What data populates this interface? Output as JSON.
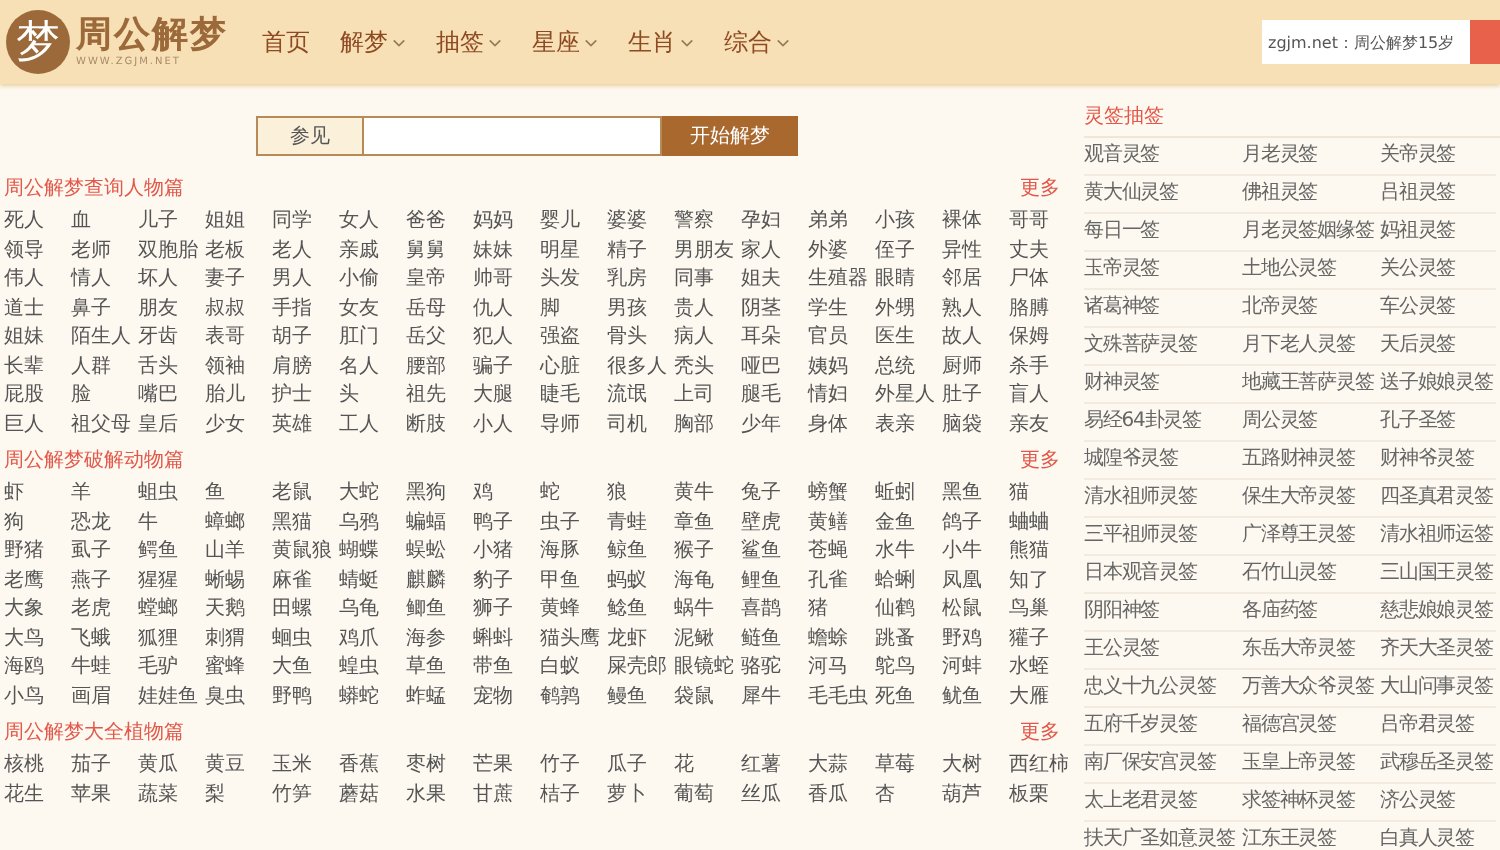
{
  "header": {
    "logo": {
      "mark": "梦",
      "title": "周公解梦",
      "subtitle": "WWW.ZGJM.NET"
    },
    "nav": [
      {
        "label": "首页",
        "has_menu": false
      },
      {
        "label": "解梦",
        "has_menu": true
      },
      {
        "label": "抽签",
        "has_menu": true
      },
      {
        "label": "星座",
        "has_menu": true
      },
      {
        "label": "生肖",
        "has_menu": true
      },
      {
        "label": "综合",
        "has_menu": true
      }
    ],
    "search": {
      "value": "zgjm.net：周公解梦15岁"
    }
  },
  "search": {
    "label": "参见",
    "button": "开始解梦"
  },
  "sections": [
    {
      "title": "周公解梦查询人物篇",
      "more": "更多",
      "items": [
        "死人",
        "血",
        "儿子",
        "姐姐",
        "同学",
        "女人",
        "爸爸",
        "妈妈",
        "婴儿",
        "婆婆",
        "警察",
        "孕妇",
        "弟弟",
        "小孩",
        "裸体",
        "哥哥",
        "领导",
        "老师",
        "双胞胎",
        "老板",
        "老人",
        "亲戚",
        "舅舅",
        "妹妹",
        "明星",
        "精子",
        "男朋友",
        "家人",
        "外婆",
        "侄子",
        "异性",
        "丈夫",
        "伟人",
        "情人",
        "坏人",
        "妻子",
        "男人",
        "小偷",
        "皇帝",
        "帅哥",
        "头发",
        "乳房",
        "同事",
        "姐夫",
        "生殖器",
        "眼睛",
        "邻居",
        "尸体",
        "道士",
        "鼻子",
        "朋友",
        "叔叔",
        "手指",
        "女友",
        "岳母",
        "仇人",
        "脚",
        "男孩",
        "贵人",
        "阴茎",
        "学生",
        "外甥",
        "熟人",
        "胳膊",
        "姐妹",
        "陌生人",
        "牙齿",
        "表哥",
        "胡子",
        "肛门",
        "岳父",
        "犯人",
        "强盗",
        "骨头",
        "病人",
        "耳朵",
        "官员",
        "医生",
        "故人",
        "保姆",
        "长辈",
        "人群",
        "舌头",
        "领袖",
        "肩膀",
        "名人",
        "腰部",
        "骗子",
        "心脏",
        "很多人",
        "秃头",
        "哑巴",
        "姨妈",
        "总统",
        "厨师",
        "杀手",
        "屁股",
        "脸",
        "嘴巴",
        "胎儿",
        "护士",
        "头",
        "祖先",
        "大腿",
        "睫毛",
        "流氓",
        "上司",
        "腿毛",
        "情妇",
        "外星人",
        "肚子",
        "盲人",
        "巨人",
        "祖父母",
        "皇后",
        "少女",
        "英雄",
        "工人",
        "断肢",
        "小人",
        "导师",
        "司机",
        "胸部",
        "少年",
        "身体",
        "表亲",
        "脑袋",
        "亲友"
      ]
    },
    {
      "title": "周公解梦破解动物篇",
      "more": "更多",
      "items": [
        "虾",
        "羊",
        "蛆虫",
        "鱼",
        "老鼠",
        "大蛇",
        "黑狗",
        "鸡",
        "蛇",
        "狼",
        "黄牛",
        "兔子",
        "螃蟹",
        "蚯蚓",
        "黑鱼",
        "猫",
        "狗",
        "恐龙",
        "牛",
        "蟑螂",
        "黑猫",
        "乌鸦",
        "蝙蝠",
        "鸭子",
        "虫子",
        "青蛙",
        "章鱼",
        "壁虎",
        "黄鳝",
        "金鱼",
        "鸽子",
        "蛐蛐",
        "野猪",
        "虱子",
        "鳄鱼",
        "山羊",
        "黄鼠狼",
        "蝴蝶",
        "蜈蚣",
        "小猪",
        "海豚",
        "鲸鱼",
        "猴子",
        "鲨鱼",
        "苍蝇",
        "水牛",
        "小牛",
        "熊猫",
        "老鹰",
        "燕子",
        "猩猩",
        "蜥蜴",
        "麻雀",
        "蜻蜓",
        "麒麟",
        "豹子",
        "甲鱼",
        "蚂蚁",
        "海龟",
        "鲤鱼",
        "孔雀",
        "蛤蜊",
        "凤凰",
        "知了",
        "大象",
        "老虎",
        "螳螂",
        "天鹅",
        "田螺",
        "乌龟",
        "鲫鱼",
        "狮子",
        "黄蜂",
        "鲶鱼",
        "蜗牛",
        "喜鹊",
        "猪",
        "仙鹤",
        "松鼠",
        "鸟巢",
        "大鸟",
        "飞蛾",
        "狐狸",
        "刺猬",
        "蛔虫",
        "鸡爪",
        "海参",
        "蝌蚪",
        "猫头鹰",
        "龙虾",
        "泥鳅",
        "鲢鱼",
        "蟾蜍",
        "跳蚤",
        "野鸡",
        "獾子",
        "海鸥",
        "牛蛙",
        "毛驴",
        "蜜蜂",
        "大鱼",
        "蝗虫",
        "草鱼",
        "带鱼",
        "白蚁",
        "屎壳郎",
        "眼镜蛇",
        "骆驼",
        "河马",
        "鸵鸟",
        "河蚌",
        "水蛭",
        "小鸟",
        "画眉",
        "娃娃鱼",
        "臭虫",
        "野鸭",
        "蟒蛇",
        "蚱蜢",
        "宠物",
        "鹌鹑",
        "鳗鱼",
        "袋鼠",
        "犀牛",
        "毛毛虫",
        "死鱼",
        "鱿鱼",
        "大雁"
      ]
    },
    {
      "title": "周公解梦大全植物篇",
      "more": "更多",
      "items": [
        "核桃",
        "茄子",
        "黄瓜",
        "黄豆",
        "玉米",
        "香蕉",
        "枣树",
        "芒果",
        "竹子",
        "瓜子",
        "花",
        "红薯",
        "大蒜",
        "草莓",
        "大树",
        "西红柿",
        "花生",
        "苹果",
        "蔬菜",
        "梨",
        "竹笋",
        "蘑菇",
        "水果",
        "甘蔗",
        "桔子",
        "萝卜",
        "葡萄",
        "丝瓜",
        "香瓜",
        "杏",
        "葫芦",
        "板栗"
      ]
    }
  ],
  "sidebar": {
    "title": "灵签抽签",
    "items": [
      "观音灵签",
      "月老灵签",
      "关帝灵签",
      "黄大仙灵签",
      "佛祖灵签",
      "吕祖灵签",
      "每日一签",
      "月老灵签姻缘签",
      "妈祖灵签",
      "玉帝灵签",
      "土地公灵签",
      "关公灵签",
      "诸葛神签",
      "北帝灵签",
      "车公灵签",
      "文殊菩萨灵签",
      "月下老人灵签",
      "天后灵签",
      "财神灵签",
      "地藏王菩萨灵签",
      "送子娘娘灵签",
      "易经64卦灵签",
      "周公灵签",
      "孔子圣签",
      "城隍爷灵签",
      "五路财神灵签",
      "财神爷灵签",
      "清水祖师灵签",
      "保生大帝灵签",
      "四圣真君灵签",
      "三平祖师灵签",
      "广泽尊王灵签",
      "清水祖师运签",
      "日本观音灵签",
      "石竹山灵签",
      "三山国王灵签",
      "阴阳神签",
      "各庙药签",
      "慈悲娘娘灵签",
      "王公灵签",
      "东岳大帝灵签",
      "齐天大圣灵签",
      "忠义十九公灵签",
      "万善大众爷灵签",
      "大山问事灵签",
      "五府千岁灵签",
      "福德宫灵签",
      "吕帝君灵签",
      "南厂保安宫灵签",
      "玉皇上帝灵签",
      "武穆岳圣灵签",
      "太上老君灵签",
      "求签神杯灵签",
      "济公灵签",
      "扶天广圣如意灵签",
      "江东王灵签",
      "白真人灵签"
    ]
  }
}
